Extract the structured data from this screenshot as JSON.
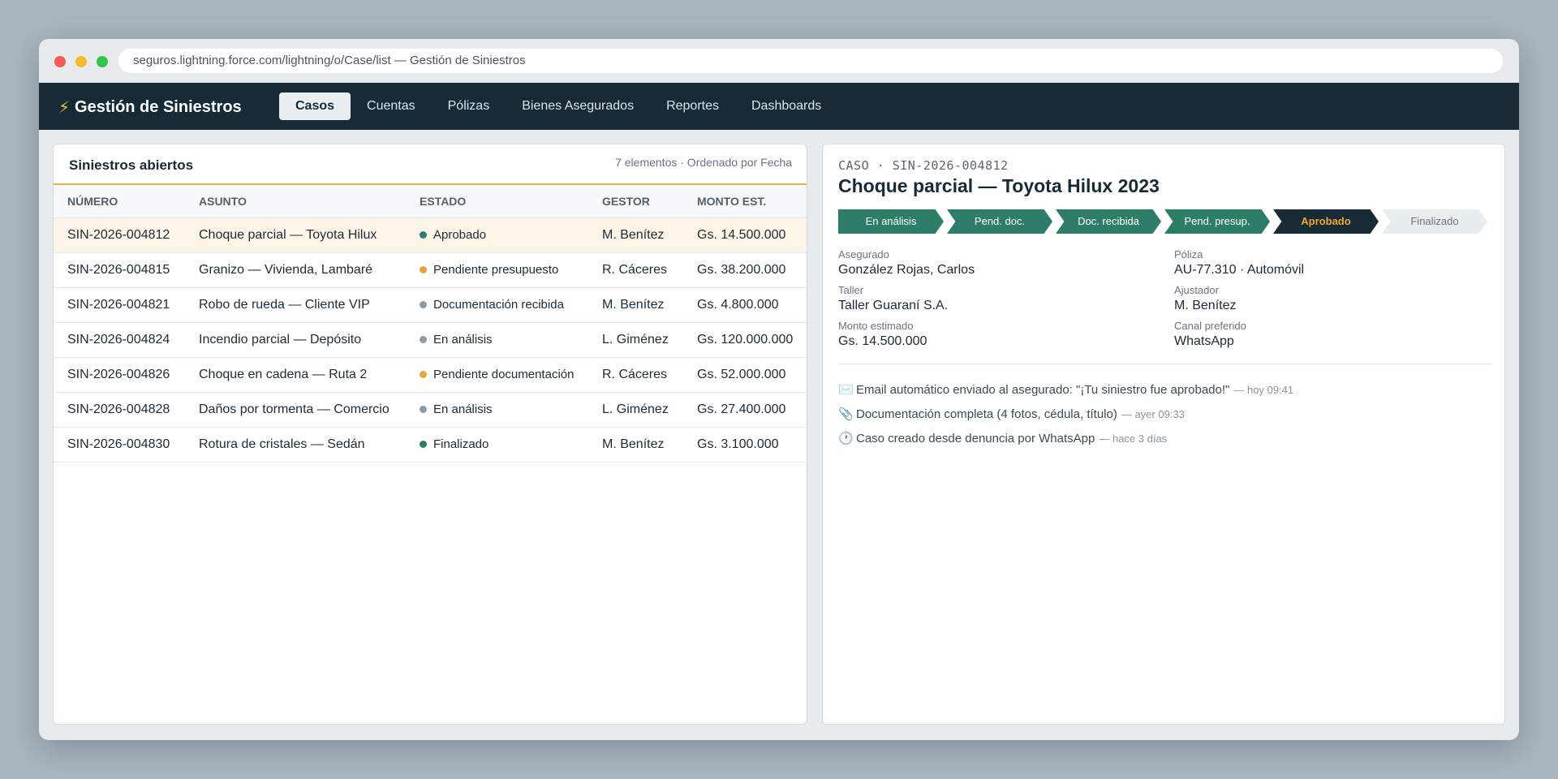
{
  "browser": {
    "url": "seguros.lightning.force.com/lightning/o/Case/list — Gestión de Siniestros"
  },
  "app": {
    "brand": "Gestión de Siniestros",
    "tabs": [
      "Casos",
      "Cuentas",
      "Pólizas",
      "Bienes Asegurados",
      "Reportes",
      "Dashboards"
    ],
    "active_tab": "Casos"
  },
  "list": {
    "title": "Siniestros abiertos",
    "meta": "7 elementos · Ordenado por Fecha",
    "columns": [
      "NÚMERO",
      "ASUNTO",
      "ESTADO",
      "GESTOR",
      "MONTO EST."
    ],
    "rows": [
      {
        "numero": "SIN-2026-004812",
        "asunto": "Choque parcial — Toyota Hilux",
        "estado": "Aprobado",
        "estado_color": "#2e7d6b",
        "gestor": "M. Benítez",
        "monto": "Gs. 14.500.000",
        "selected": true
      },
      {
        "numero": "SIN-2026-004815",
        "asunto": "Granizo — Vivienda, Lambaré",
        "estado": "Pendiente presupuesto",
        "estado_color": "#e8a33a",
        "gestor": "R. Cáceres",
        "monto": "Gs. 38.200.000",
        "selected": false
      },
      {
        "numero": "SIN-2026-004821",
        "asunto": "Robo de rueda — Cliente VIP",
        "estado": "Documentación recibida",
        "estado_color": "#8a9aa6",
        "gestor": "M. Benítez",
        "monto": "Gs. 4.800.000",
        "selected": false
      },
      {
        "numero": "SIN-2026-004824",
        "asunto": "Incendio parcial — Depósito",
        "estado": "En análisis",
        "estado_color": "#8a9aa6",
        "gestor": "L. Giménez",
        "monto": "Gs. 120.000.000",
        "selected": false
      },
      {
        "numero": "SIN-2026-004826",
        "asunto": "Choque en cadena — Ruta 2",
        "estado": "Pendiente documentación",
        "estado_color": "#e8a33a",
        "gestor": "R. Cáceres",
        "monto": "Gs. 52.000.000",
        "selected": false
      },
      {
        "numero": "SIN-2026-004828",
        "asunto": "Daños por tormenta — Comercio",
        "estado": "En análisis",
        "estado_color": "#8a9aa6",
        "gestor": "L. Giménez",
        "monto": "Gs. 27.400.000",
        "selected": false
      },
      {
        "numero": "SIN-2026-004830",
        "asunto": "Rotura de cristales — Sedán",
        "estado": "Finalizado",
        "estado_color": "#2e7d6b",
        "gestor": "M. Benítez",
        "monto": "Gs. 3.100.000",
        "selected": false
      }
    ]
  },
  "detail": {
    "case_label": "CASO · SIN-2026-004812",
    "title": "Choque parcial — Toyota Hilux 2023",
    "path": [
      {
        "label": "En análisis",
        "state": "done"
      },
      {
        "label": "Pend. doc.",
        "state": "done"
      },
      {
        "label": "Doc. recibida",
        "state": "done"
      },
      {
        "label": "Pend. presup.",
        "state": "done"
      },
      {
        "label": "Aprobado",
        "state": "current"
      },
      {
        "label": "Finalizado",
        "state": "future"
      }
    ],
    "fields": [
      {
        "label": "Asegurado",
        "value": "González Rojas, Carlos"
      },
      {
        "label": "Póliza",
        "value": "AU-77.310 · Automóvil"
      },
      {
        "label": "Taller",
        "value": "Taller Guaraní S.A."
      },
      {
        "label": "Ajustador",
        "value": "M. Benítez"
      },
      {
        "label": "Monto estimado",
        "value": "Gs. 14.500.000"
      },
      {
        "label": "Canal preferido",
        "value": "WhatsApp"
      }
    ],
    "timeline": [
      {
        "icon": "envelope-icon",
        "glyph": "✉️",
        "text": "Email automático enviado al asegurado: \"¡Tu siniestro fue aprobado!\"",
        "when": "— hoy 09:41"
      },
      {
        "icon": "paperclip-icon",
        "glyph": "📎",
        "text": "Documentación completa (4 fotos, cédula, título)",
        "when": "— ayer 09:33"
      },
      {
        "icon": "clock-icon",
        "glyph": "🕐",
        "text": "Caso creado desde denuncia por WhatsApp",
        "when": "— hace 3 días"
      }
    ]
  },
  "colors": {
    "nav_bg": "#172b36",
    "accent": "#e3b44a",
    "path_done": "#2e7d6b",
    "path_current_text": "#f0a930"
  }
}
